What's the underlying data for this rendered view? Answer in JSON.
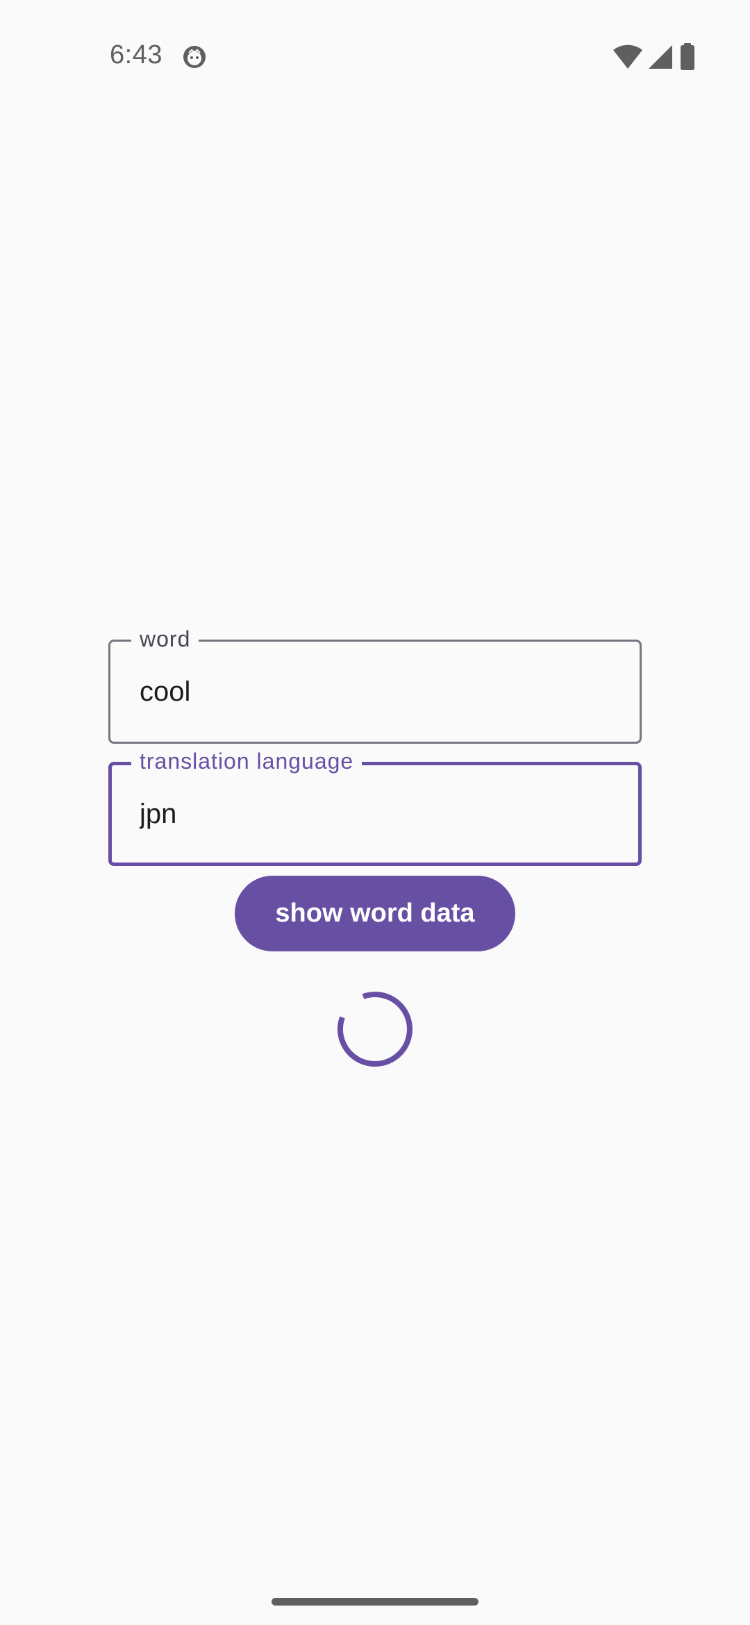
{
  "status_bar": {
    "time": "6:43",
    "icons": [
      "notification-face-icon",
      "wifi-icon",
      "cellular-signal-icon",
      "battery-icon"
    ]
  },
  "form": {
    "word": {
      "label": "word",
      "value": "cool"
    },
    "translation_language": {
      "label": "translation language",
      "value": "jpn"
    },
    "submit_label": "show word data"
  },
  "loading": {
    "indicator": "circular-progress-spinner"
  },
  "colors": {
    "primary": "#6750a4",
    "outline": "#79747e",
    "background": "#fafafa",
    "status_icon": "#5f5f5f"
  }
}
